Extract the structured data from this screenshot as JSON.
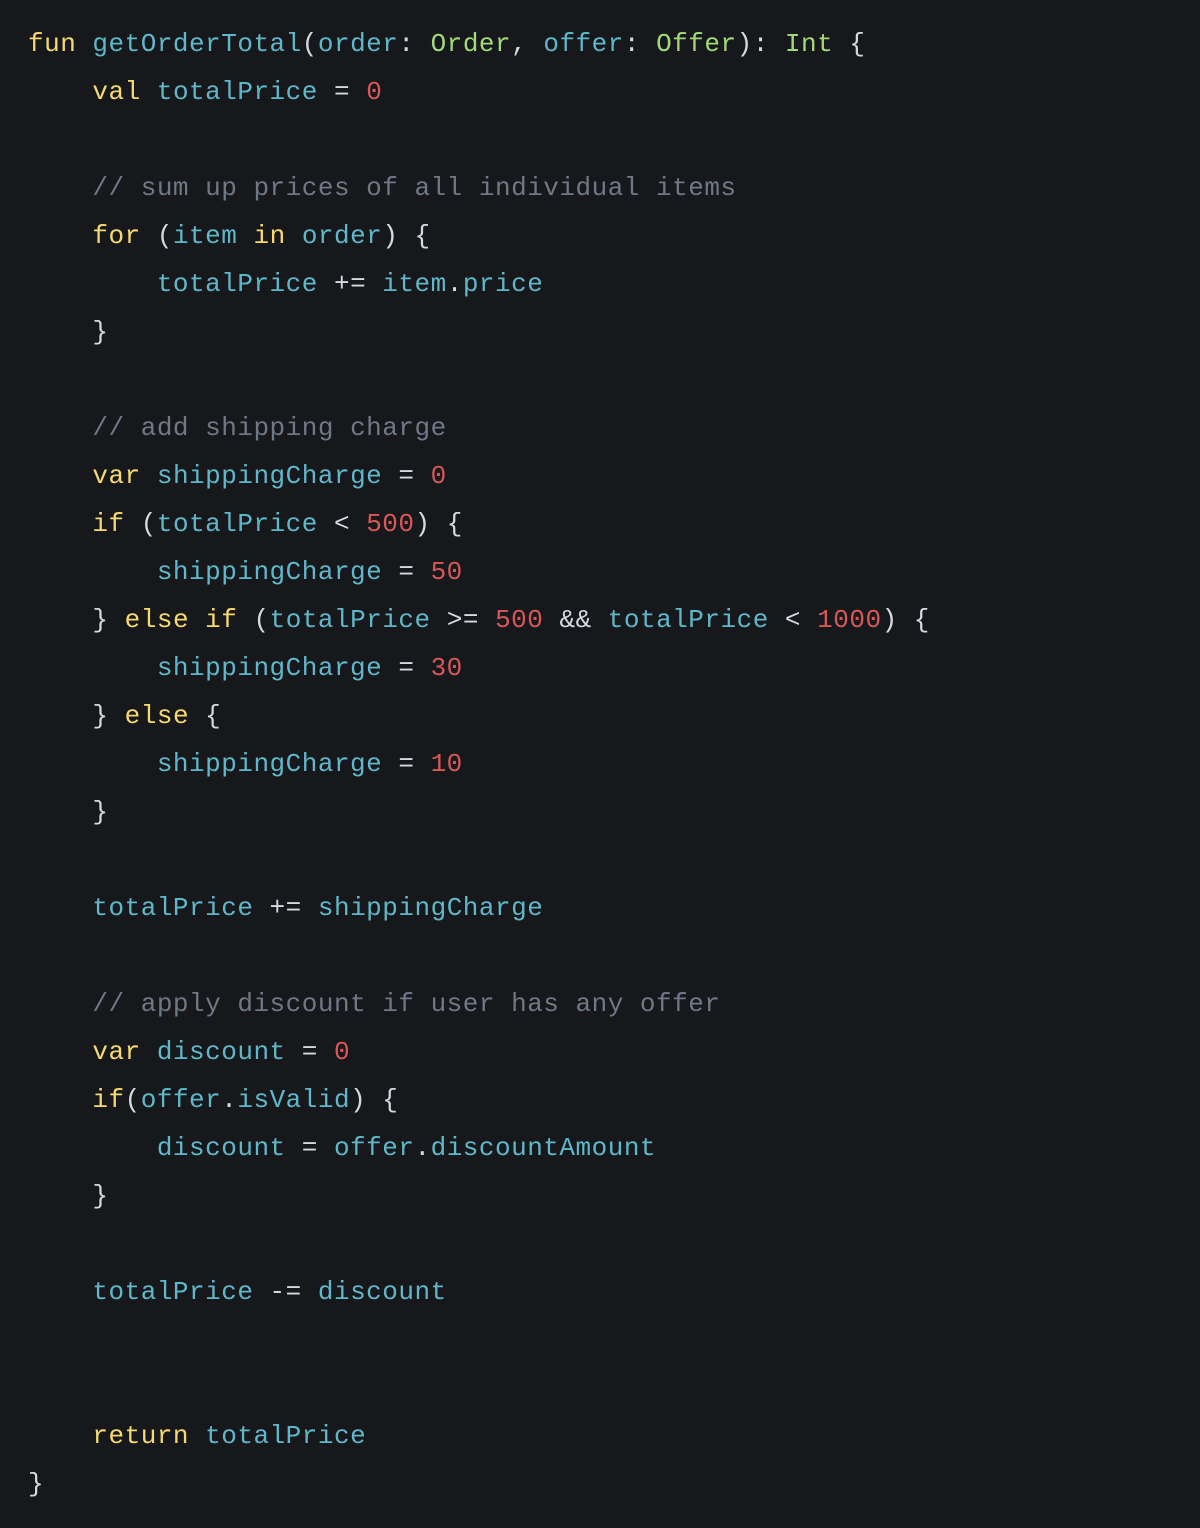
{
  "code": {
    "t1": "fun",
    "t2": "getOrderTotal",
    "t3": "(",
    "t4": "order",
    "t5": ": ",
    "t6": "Order",
    "t7": ", ",
    "t8": "offer",
    "t9": ": ",
    "t10": "Offer",
    "t11": "): ",
    "t12": "Int",
    "t13": " {",
    "t14": "val",
    "t15": "totalPrice",
    "t16": " = ",
    "t17": "0",
    "t18": "// sum up prices of all individual items",
    "t19": "for",
    "t20": " (",
    "t21": "item",
    "t22": "in",
    "t23": "order",
    "t24": ") {",
    "t25": "totalPrice",
    "t26": " += ",
    "t27": "item",
    "t28": ".",
    "t29": "price",
    "t30": "}",
    "t31": "// add shipping charge",
    "t32": "var",
    "t33": "shippingCharge",
    "t34": " = ",
    "t35": "0",
    "t36": "if",
    "t37": " (",
    "t38": "totalPrice",
    "t39": " < ",
    "t40": "500",
    "t41": ") {",
    "t42": "shippingCharge",
    "t43": " = ",
    "t44": "50",
    "t45": "} ",
    "t46": "else",
    "t47": "if",
    "t48": " (",
    "t49": "totalPrice",
    "t50": " >= ",
    "t51": "500",
    "t52": " && ",
    "t53": "totalPrice",
    "t54": " < ",
    "t55": "1000",
    "t56": ") {",
    "t57": "shippingCharge",
    "t58": " = ",
    "t59": "30",
    "t60": "} ",
    "t61": "else",
    "t62": " {",
    "t63": "shippingCharge",
    "t64": " = ",
    "t65": "10",
    "t66": "}",
    "t67": "totalPrice",
    "t68": " += ",
    "t69": "shippingCharge",
    "t70": "// apply discount if user has any offer",
    "t71": "var",
    "t72": "discount",
    "t73": " = ",
    "t74": "0",
    "t75": "if",
    "t76": "(",
    "t77": "offer",
    "t78": ".",
    "t79": "isValid",
    "t80": ") {",
    "t81": "discount",
    "t82": " = ",
    "t83": "offer",
    "t84": ".",
    "t85": "discountAmount",
    "t86": "}",
    "t87": "totalPrice",
    "t88": " -= ",
    "t89": "discount",
    "t90": "return",
    "t91": "totalPrice",
    "t92": "}"
  }
}
